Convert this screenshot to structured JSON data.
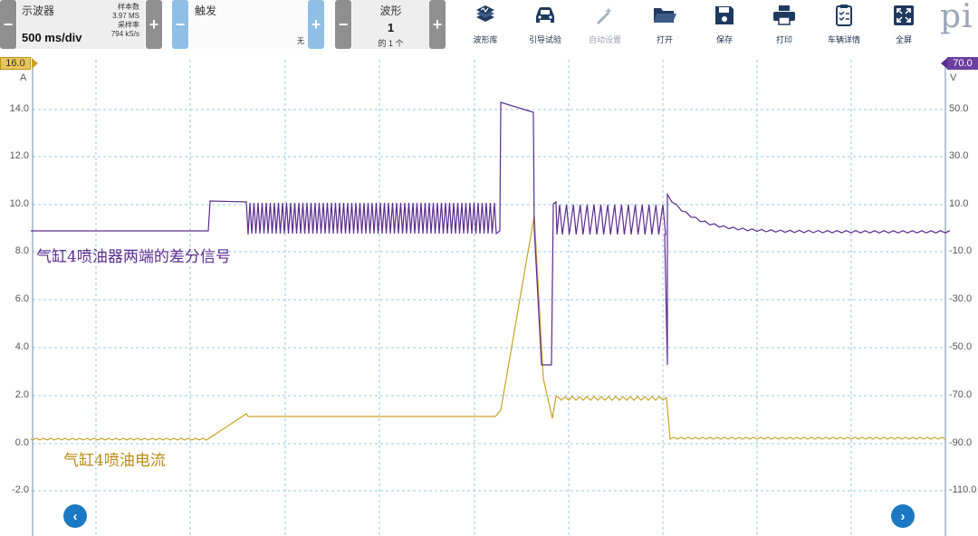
{
  "toolbar": {
    "oscilloscope": {
      "title": "示波器",
      "timebase": "500 ms/div",
      "samples_label": "样本数",
      "samples_value": "3.97 MS",
      "rate_label": "采样率",
      "rate_value": "794 kS/s",
      "minus": "−",
      "plus": "+"
    },
    "trigger": {
      "title": "触发",
      "mode": "无",
      "minus": "−",
      "plus": "+"
    },
    "waveform": {
      "title": "波形",
      "number": "1",
      "of_total": "的 1 个",
      "minus": "−",
      "plus": "+"
    },
    "tools": [
      {
        "label": "波形库",
        "icon": "waveform-library-icon"
      },
      {
        "label": "引导试验",
        "icon": "car-icon"
      },
      {
        "label": "自动设置",
        "icon": "magic-wand-icon"
      },
      {
        "label": "打开",
        "icon": "folder-icon"
      },
      {
        "label": "保存",
        "icon": "save-icon"
      },
      {
        "label": "打印",
        "icon": "printer-icon"
      },
      {
        "label": "车辆详情",
        "icon": "clipboard-icon"
      },
      {
        "label": "全屏",
        "icon": "fullscreen-icon"
      }
    ],
    "logo_text": "pi"
  },
  "axes": {
    "left": {
      "unit": "A",
      "range_marker": "16.0",
      "ticks": [
        "14.0",
        "12.0",
        "10.0",
        "8.0",
        "6.0",
        "4.0",
        "2.0",
        "0.0",
        "-2.0"
      ]
    },
    "right": {
      "unit": "V",
      "range_marker": "70.0",
      "ticks": [
        "50.0",
        "30.0",
        "10.0",
        "-10.0",
        "-30.0",
        "-50.0",
        "-70.0",
        "-90.0",
        "-110.0"
      ]
    }
  },
  "annotations": {
    "voltage_trace": "气缸4喷油器两端的差分信号",
    "current_trace": "气缸4喷油电流"
  },
  "colors": {
    "voltage": "#5b2c8e",
    "current": "#c9a227",
    "grid": "#9ec7e0",
    "accent": "#1b78c2"
  },
  "nav": {
    "left": "‹",
    "right": "›"
  }
}
